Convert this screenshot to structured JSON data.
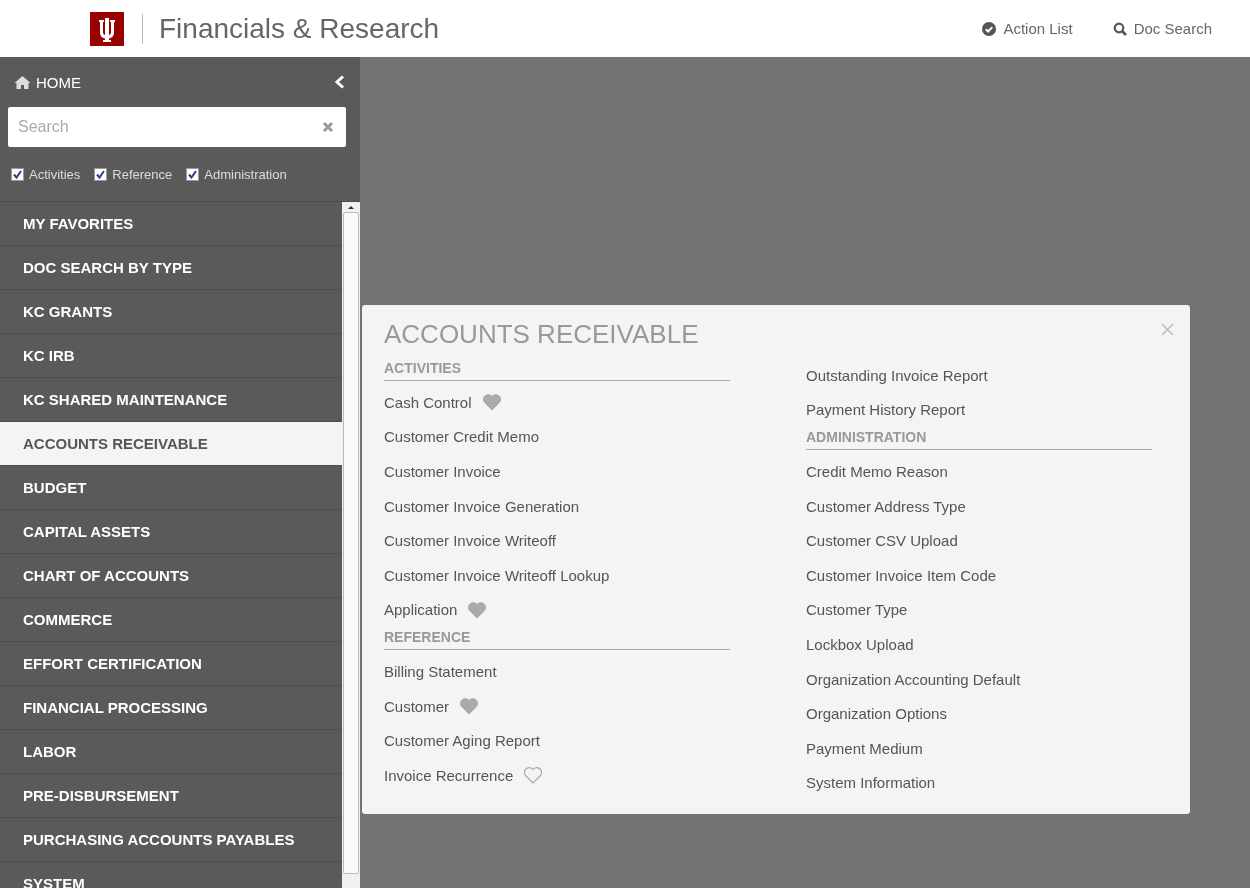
{
  "header": {
    "title": "Financials & Research",
    "links": [
      {
        "kind": "action",
        "label": "Action List"
      },
      {
        "kind": "search",
        "label": "Doc Search"
      }
    ]
  },
  "sidebar": {
    "home": "HOME",
    "search": {
      "placeholder": "Search"
    },
    "filters": [
      {
        "label": "Activities",
        "checked": true
      },
      {
        "label": "Reference",
        "checked": true
      },
      {
        "label": "Administration",
        "checked": true
      }
    ],
    "items": [
      {
        "label": "MY FAVORITES",
        "selected": false
      },
      {
        "label": "DOC SEARCH BY TYPE",
        "selected": false
      },
      {
        "label": "KC GRANTS",
        "selected": false
      },
      {
        "label": "KC IRB",
        "selected": false
      },
      {
        "label": "KC SHARED MAINTENANCE",
        "selected": false
      },
      {
        "label": "ACCOUNTS RECEIVABLE",
        "selected": true
      },
      {
        "label": "BUDGET",
        "selected": false
      },
      {
        "label": "CAPITAL ASSETS",
        "selected": false
      },
      {
        "label": "CHART OF ACCOUNTS",
        "selected": false
      },
      {
        "label": "COMMERCE",
        "selected": false
      },
      {
        "label": "EFFORT CERTIFICATION",
        "selected": false
      },
      {
        "label": "FINANCIAL PROCESSING",
        "selected": false
      },
      {
        "label": "LABOR",
        "selected": false
      },
      {
        "label": "PRE-DISBURSEMENT",
        "selected": false
      },
      {
        "label": "PURCHASING ACCOUNTS PAYABLES",
        "selected": false
      },
      {
        "label": "SYSTEM",
        "selected": false
      }
    ]
  },
  "panel": {
    "title": "ACCOUNTS RECEIVABLE",
    "columns": [
      [
        {
          "heading": "ACTIVITIES",
          "items": [
            {
              "label": "Cash Control",
              "favorite": true
            },
            {
              "label": "Customer Credit Memo"
            },
            {
              "label": "Customer Invoice"
            },
            {
              "label": "Customer Invoice Generation"
            },
            {
              "label": "Customer Invoice Writeoff"
            },
            {
              "label": "Customer Invoice Writeoff Lookup"
            },
            {
              "label": "Application",
              "favorite": true
            }
          ]
        },
        {
          "heading": "REFERENCE",
          "items": [
            {
              "label": "Billing Statement"
            },
            {
              "label": "Customer",
              "favorite": true
            },
            {
              "label": "Customer Aging Report"
            },
            {
              "label": "Invoice Recurrence",
              "favorite": false
            }
          ]
        }
      ],
      [
        {
          "items": [
            {
              "label": "Outstanding Invoice Report"
            },
            {
              "label": "Payment History Report"
            }
          ]
        },
        {
          "heading": "ADMINISTRATION",
          "items": [
            {
              "label": "Credit Memo Reason"
            },
            {
              "label": "Customer Address Type"
            },
            {
              "label": "Customer CSV Upload"
            },
            {
              "label": "Customer Invoice Item Code"
            },
            {
              "label": "Customer Type"
            },
            {
              "label": "Lockbox Upload"
            },
            {
              "label": "Organization Accounting Default"
            },
            {
              "label": "Organization Options"
            },
            {
              "label": "Payment Medium"
            },
            {
              "label": "System Information"
            }
          ]
        }
      ]
    ]
  }
}
